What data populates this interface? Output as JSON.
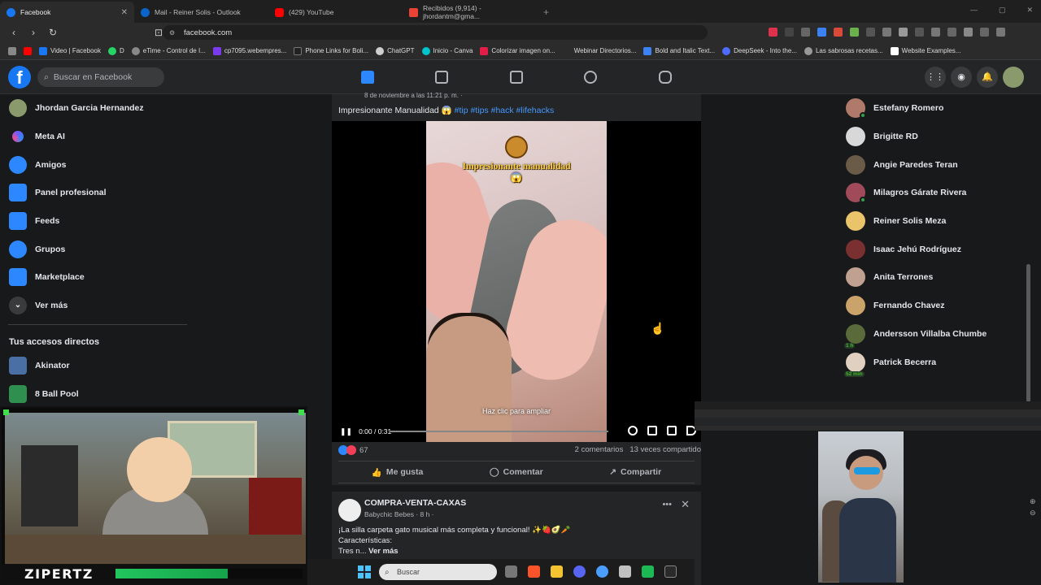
{
  "browser": {
    "tabs": [
      {
        "label": "Facebook",
        "color": "#1877f2",
        "active": true
      },
      {
        "label": "Mail - Reiner Solis - Outlook",
        "color": "#0a64c9"
      },
      {
        "label": "(429) YouTube",
        "color": "#ff0000"
      },
      {
        "label": "Recibidos (9,914) - jhordantm@gma...",
        "color": "#ea4335"
      }
    ],
    "new_tab": "+",
    "url": "facebook.com",
    "bookmarks": [
      {
        "label": "",
        "color": "#ff0000"
      },
      {
        "label": "Video | Facebook",
        "color": "#1877f2"
      },
      {
        "label": "D",
        "color": "#25d366"
      },
      {
        "label": "eTime - Control de I...",
        "color": "#888"
      },
      {
        "label": "cp7095.webempres...",
        "color": "#7c3aed"
      },
      {
        "label": "Phone Links for Boli...",
        "color": "#222"
      },
      {
        "label": "ChatGPT",
        "color": "#cfcfcf"
      },
      {
        "label": "Inicio - Canva",
        "color": "#00c4cc"
      },
      {
        "label": "Colorizar imagen on...",
        "color": "#e11d48"
      },
      {
        "label": "Webinar Directorios...",
        "color": "#2b2b2b"
      },
      {
        "label": "Bold and Italic Text...",
        "color": "#3b82f6"
      },
      {
        "label": "DeepSeek - Into the...",
        "color": "#4d6bfe"
      },
      {
        "label": "Las sabrosas recetas...",
        "color": "#999"
      },
      {
        "label": "Website Examples...",
        "color": "#ffffff"
      }
    ]
  },
  "facebook": {
    "logo": "f",
    "search_placeholder": "Buscar en Facebook",
    "left_nav": [
      {
        "label": "Jhordan Garcia Hernandez",
        "icon": "avatar-icon",
        "color": "#8a9a6c"
      },
      {
        "label": "Meta AI",
        "icon": "meta-ai-icon",
        "color": "#6b5cff"
      },
      {
        "label": "Amigos",
        "icon": "friends-icon",
        "color": "#2d88ff"
      },
      {
        "label": "Panel profesional",
        "icon": "dashboard-icon",
        "color": "#2d88ff"
      },
      {
        "label": "Feeds",
        "icon": "feeds-icon",
        "color": "#2d88ff"
      },
      {
        "label": "Grupos",
        "icon": "groups-icon",
        "color": "#2d88ff"
      },
      {
        "label": "Marketplace",
        "icon": "marketplace-icon",
        "color": "#2d88ff"
      },
      {
        "label": "Ver más",
        "icon": "chevron-down-icon",
        "color": "#3a3b3c"
      }
    ],
    "shortcuts_title": "Tus accesos directos",
    "shortcuts": [
      {
        "label": "Akinator",
        "color": "#4a6fa5"
      },
      {
        "label": "8 Ball Pool",
        "color": "#2f8f4e"
      }
    ],
    "post": {
      "date": "8 de noviembre a las 11:21 p. m. · ",
      "caption": "Impresionante Manualidad 😱 ",
      "hashtags": "#tip #tips #hack #lifehacks",
      "video_title": "Impresionante manualidad",
      "video_emoji": "😱",
      "video_hint": "Haz clic para ampliar",
      "video_time": "0:00 / 0:31",
      "video_progress": 0,
      "reaction_count": "67",
      "comments": "2 comentarios",
      "shares": "13 veces compartido",
      "like": "Me gusta",
      "comment": "Comentar",
      "share": "Compartir"
    },
    "post2": {
      "name": "COMPRA-VENTA-CAXAS",
      "meta": "Babychic Bebes · 8 h · ",
      "text1": "¡La silla carpeta gato musical más completa y funcional! ✨🍓🥑🥕",
      "text2": "Características:",
      "text3": "Tres n... ",
      "more": "Ver más"
    },
    "contacts": [
      {
        "name": "Estefany Romero",
        "color": "#b07a6a",
        "online": true
      },
      {
        "name": "Brigitte RD",
        "color": "#d8d8d8",
        "online": false
      },
      {
        "name": "Angie Paredes Teran",
        "color": "#6a5a48",
        "online": false
      },
      {
        "name": "Milagros Gárate Rivera",
        "color": "#a04a5a",
        "online": true
      },
      {
        "name": "Reiner Solis Meza",
        "color": "#e9c46a",
        "online": false
      },
      {
        "name": "Isaac Jehú Rodríguez",
        "color": "#7a3030",
        "online": false
      },
      {
        "name": "Anita Terrones",
        "color": "#c0a090",
        "online": false
      },
      {
        "name": "Fernando Chavez",
        "color": "#c9a36a",
        "online": false
      },
      {
        "name": "Andersson Villalba Chumbe",
        "color": "#5a6a3a",
        "online": false,
        "badge": "1 h"
      },
      {
        "name": "Patrick Becerra",
        "color": "#e0d0c0",
        "online": false,
        "badge": "52 min"
      }
    ]
  },
  "overlay": {
    "streamer_name": "ZIPERTZ"
  },
  "taskbar": {
    "search_placeholder": "Buscar",
    "apps": [
      "#4cc2ff",
      "#fb542b",
      "#f4c430",
      "#5865f2",
      "#4a9eff",
      "#c0c0c0",
      "#1db954",
      "#2a2a2a"
    ]
  }
}
